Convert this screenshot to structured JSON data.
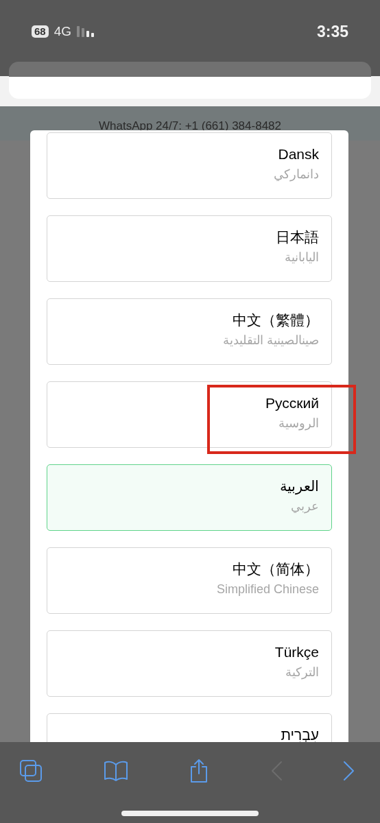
{
  "status_bar": {
    "battery": "68",
    "network": "4G",
    "time": "3:35"
  },
  "banner": {
    "text": "WhatsApp 24/7: +1 (661) 384-8482"
  },
  "languages": [
    {
      "name": "Dansk",
      "subtitle": "دانماركي",
      "selected": false,
      "marked": false
    },
    {
      "name": "日本語",
      "subtitle": "اليابانية",
      "selected": false,
      "marked": false
    },
    {
      "name": "中文（繁體）",
      "subtitle": "صينالصينية التقليدية",
      "selected": false,
      "marked": false
    },
    {
      "name": "Русский",
      "subtitle": "الروسية",
      "selected": false,
      "marked": true
    },
    {
      "name": "العربية",
      "subtitle": "عربي",
      "selected": true,
      "marked": false
    },
    {
      "name": "中文（简体）",
      "subtitle": "Simplified Chinese",
      "selected": false,
      "marked": false
    },
    {
      "name": "Türkçe",
      "subtitle": "التركية",
      "selected": false,
      "marked": false
    },
    {
      "name": "עִבְרִית",
      "selected": false,
      "marked": false
    }
  ],
  "toolbar": [
    {
      "kind": "tabs",
      "disabled": false
    },
    {
      "kind": "bookmarks",
      "disabled": false
    },
    {
      "kind": "share",
      "disabled": false
    },
    {
      "kind": "back",
      "disabled": true
    },
    {
      "kind": "forward",
      "disabled": false
    }
  ]
}
